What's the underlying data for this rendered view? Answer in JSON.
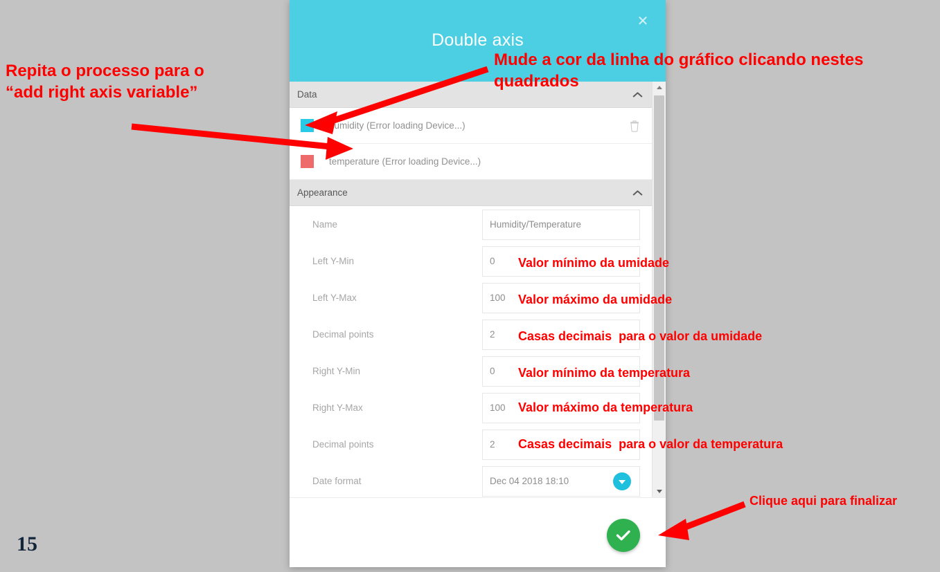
{
  "page": {
    "number": "15",
    "background_color": "#c3c3c3"
  },
  "dialog": {
    "title": "Double axis",
    "header_color": "#4ccfe3",
    "close_icon": "close-icon",
    "sections": {
      "data": {
        "title": "Data",
        "rows": [
          {
            "color": "#29c9e8",
            "label": "humidity (Error loading Device...)",
            "has_delete": true
          },
          {
            "color": "#ef6b6b",
            "label": "temperature (Error loading Device...)",
            "has_delete": false
          }
        ]
      },
      "appearance": {
        "title": "Appearance",
        "fields": [
          {
            "label": "Name",
            "value": "Humidity/Temperature",
            "type": "text"
          },
          {
            "label": "Left Y-Min",
            "value": "0",
            "type": "text"
          },
          {
            "label": "Left Y-Max",
            "value": "100",
            "type": "text"
          },
          {
            "label": "Decimal points",
            "value": "2",
            "type": "text"
          },
          {
            "label": "Right Y-Min",
            "value": "0",
            "type": "text"
          },
          {
            "label": "Right Y-Max",
            "value": "100",
            "type": "text"
          },
          {
            "label": "Decimal points",
            "value": "2",
            "type": "text"
          },
          {
            "label": "Date format",
            "value": "Dec 04 2018 18:10",
            "type": "select"
          }
        ]
      }
    },
    "confirm_button": {
      "icon": "check-icon",
      "color": "#30b14f"
    },
    "scrollbar": {
      "up_icon": "caret-up-icon",
      "down_icon": "caret-down-icon"
    }
  },
  "annotations": {
    "left": "Repita o processo para o\n“add right axis variable”",
    "top": "Mude a cor da linha do gráfico clicando nestes\nquadrados",
    "humidity_min": "Valor mínimo da umidade",
    "humidity_max": "Valor máximo da umidade",
    "humidity_dec": "Casas decimais  para o valor da umidade",
    "temperature_min": "Valor mínimo da temperatura",
    "temperature_max": "Valor máximo da temperatura",
    "temperature_dec": "Casas decimais  para o valor da temperatura",
    "finish": "Clique aqui para finalizar",
    "color": "#ff0000"
  }
}
